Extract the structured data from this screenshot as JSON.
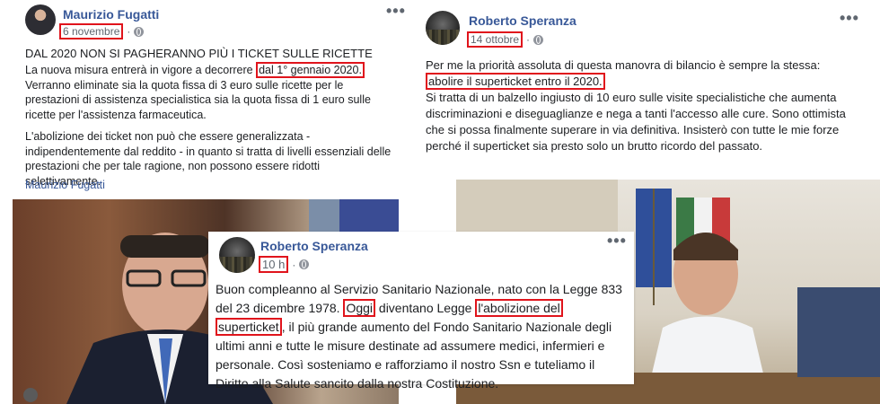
{
  "post1": {
    "author": "Maurizio Fugatti",
    "date": "6 novembre",
    "dot": "·",
    "title": "DAL 2020 NON SI PAGHERANNO PIÙ I TICKET SULLE RICETTE",
    "p1_a": "La nuova misura entrerà in vigore a decorrere ",
    "p1_hl": "dal 1° gennaio 2020.",
    "p1_b": "Verranno eliminate sia la quota fissa di 3 euro sulle ricette per le prestazioni di assistenza specialistica sia la quota fissa di 1 euro sulle ricette per l'assistenza farmaceutica.",
    "p2": "L'abolizione dei ticket non può che essere generalizzata - indipendentemente dal reddito - in quanto si tratta di livelli essenziali delle prestazioni che per tale ragione, non possono essere ridotti selettivamente.",
    "signature": "Maurizio Fugatti"
  },
  "post2": {
    "author": "Roberto Speranza",
    "date": "14 ottobre",
    "dot": "·",
    "p_a": "Per me la priorità assoluta di questa manovra di bilancio è sempre la stessa:",
    "p_hl": "abolire il superticket entro il 2020.",
    "p_b": "Si tratta di un balzello ingiusto di 10 euro sulle visite specialistiche che aumenta discriminazioni e diseguaglianze e nega a tanti l'accesso alle cure. Sono ottimista che si possa finalmente superare in via definitiva. Insisterò con tutte le mie forze perché il superticket sia presto solo un brutto ricordo del passato."
  },
  "post3": {
    "author": "Roberto Speranza",
    "date": "10 h",
    "dot": "·",
    "t_a": "Buon compleanno al Servizio Sanitario Nazionale, nato con la Legge 833 del 23 dicembre 1978. ",
    "t_hl1": "Oggi",
    "t_b": " diventano Legge ",
    "t_hl2": "l'abolizione del",
    "t_hl3": "superticket",
    "t_c": ", il più grande aumento del Fondo Sanitario Nazionale degli ultimi anni e tutte le misure destinate ad assumere medici, infermieri e personale. Così sosteniamo e rafforziamo il nostro Ssn e tuteliamo il Diritto alla Salute sancito dalla nostra Costituzione."
  },
  "menu": "•••",
  "colors": {
    "highlight": "#e0141c",
    "link": "#385898"
  }
}
